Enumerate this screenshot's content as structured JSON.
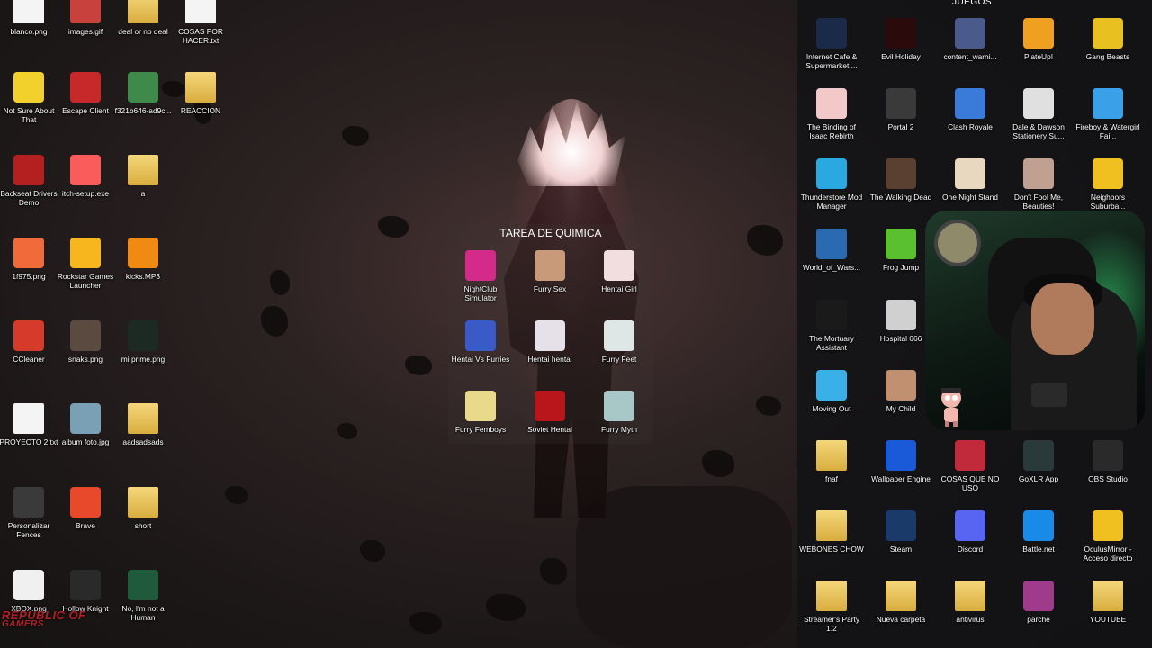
{
  "desktop_left": [
    {
      "label": "blanco.png",
      "icon": "white-image-icon",
      "color": "#f4f4f4"
    },
    {
      "label": "images.gif",
      "icon": "image-thumbnail-icon",
      "color": "#c9413d"
    },
    {
      "label": "deal or no deal",
      "icon": "folder-icon",
      "color": "#e9c45c"
    },
    {
      "label": "COSAS POR HACER.txt",
      "icon": "text-file-icon",
      "color": "#f4f4f4"
    },
    {
      "label": "Not Sure About That",
      "icon": "duck-icon",
      "color": "#f3d12c"
    },
    {
      "label": "Escape Client",
      "icon": "red-hexagon-icon",
      "color": "#c7282a"
    },
    {
      "label": "f321b646-ad9c...",
      "icon": "game-image-icon",
      "color": "#3f8a4a"
    },
    {
      "label": "REACCION",
      "icon": "folder-icon",
      "color": "#e9c45c"
    },
    {
      "label": "Backseat Drivers Demo",
      "icon": "red-car-icon",
      "color": "#b3201f"
    },
    {
      "label": "itch-setup.exe",
      "icon": "itch-gamepad-icon",
      "color": "#fa5c5c"
    },
    {
      "label": "a",
      "icon": "folder-icon",
      "color": "#e9c45c"
    },
    {
      "label": "1f975.png",
      "icon": "hot-face-emoji-icon",
      "color": "#f06a3a"
    },
    {
      "label": "Rockstar Games Launcher",
      "icon": "rockstar-icon",
      "color": "#f7b51e"
    },
    {
      "label": "kicks.MP3",
      "icon": "vlc-cone-icon",
      "color": "#f08a13"
    },
    {
      "label": "CCleaner",
      "icon": "ccleaner-icon",
      "color": "#d63a2a"
    },
    {
      "label": "snaks.png",
      "icon": "image-thumbnail-icon",
      "color": "#5a4a40"
    },
    {
      "label": "mi prime.png",
      "icon": "dark-image-icon",
      "color": "#1d2a24"
    },
    {
      "label": "PROYECTO 2.txt",
      "icon": "text-file-icon",
      "color": "#f4f4f4"
    },
    {
      "label": "album foto.jpg",
      "icon": "minecraft-image-icon",
      "color": "#7aa0b5"
    },
    {
      "label": "aadsadsads",
      "icon": "folder-icon",
      "color": "#e9c45c"
    },
    {
      "label": "Personalizar Fences",
      "icon": "fences-icon",
      "color": "#3a3a3a"
    },
    {
      "label": "Brave",
      "icon": "brave-lion-icon",
      "color": "#e8492b"
    },
    {
      "label": "short",
      "icon": "folder-icon",
      "color": "#e9c45c"
    },
    {
      "label": "XBOX.png",
      "icon": "game-pass-icon",
      "color": "#f0f0f0"
    },
    {
      "label": "Hollow Knight",
      "icon": "hollow-knight-icon",
      "color": "#2a2a2a"
    },
    {
      "label": "No, I'm not a Human",
      "icon": "green-face-icon",
      "color": "#1f5a3c"
    }
  ],
  "fence": {
    "title": "TAREA DE QUIMICA",
    "items": [
      {
        "label": "NightClub Simulator",
        "icon": "nightclub-icon",
        "color": "#d42a8a"
      },
      {
        "label": "Furry Sex",
        "icon": "anime-thumbnail-icon",
        "color": "#c89a7a"
      },
      {
        "label": "Hentai Girl",
        "icon": "anime-girl-icon",
        "color": "#f2dede"
      },
      {
        "label": "Hentai Vs Furries",
        "icon": "anime-blue-icon",
        "color": "#3a5ac8"
      },
      {
        "label": "Hentai hentai",
        "icon": "anime-white-hair-icon",
        "color": "#e6e0e8"
      },
      {
        "label": "Furry Feet",
        "icon": "furry-feet-icon",
        "color": "#dfe6e6"
      },
      {
        "label": "Furry Femboys",
        "icon": "anime-blonde-icon",
        "color": "#e9d98a"
      },
      {
        "label": "Soviet Hentai",
        "icon": "hentai-logo-icon",
        "color": "#b8161b"
      },
      {
        "label": "Furry Myth",
        "icon": "furry-myth-icon",
        "color": "#a8c8c8"
      }
    ]
  },
  "panel": {
    "title": "JUEGOS",
    "items": [
      {
        "label": "Internet Cafe & Supermarket ...",
        "icon": "internet-cafe-icon",
        "color": "#1c2a4a"
      },
      {
        "label": "Evil Holiday",
        "icon": "evil-holiday-icon",
        "color": "#2a0a0a"
      },
      {
        "label": "content_warni...",
        "icon": "content-warning-icon",
        "color": "#4a5a8a"
      },
      {
        "label": "PlateUp!",
        "icon": "plateup-icon",
        "color": "#f0a020"
      },
      {
        "label": "Gang Beasts",
        "icon": "gang-beasts-icon",
        "color": "#e8c020"
      },
      {
        "label": "The Binding of Isaac Rebirth",
        "icon": "isaac-icon",
        "color": "#f2c8c8"
      },
      {
        "label": "Portal 2",
        "icon": "portal-icon",
        "color": "#3a3a3a"
      },
      {
        "label": "Clash Royale",
        "icon": "clash-royale-icon",
        "color": "#3a7ad8"
      },
      {
        "label": "Dale & Dawson Stationery Su...",
        "icon": "printer-icon",
        "color": "#e0e0e0"
      },
      {
        "label": "Fireboy & Watergirl Fai...",
        "icon": "fireboy-watergirl-icon",
        "color": "#3aa0e8"
      },
      {
        "label": "Thunderstore Mod Manager",
        "icon": "thunderstore-icon",
        "color": "#2aa8e0"
      },
      {
        "label": "The Walking Dead",
        "icon": "zombie-icon",
        "color": "#5a4030"
      },
      {
        "label": "One Night Stand",
        "icon": "one-night-stand-icon",
        "color": "#e8d8c0"
      },
      {
        "label": "Don't Fool Me, Beauties!",
        "icon": "beauties-icon",
        "color": "#c0a090"
      },
      {
        "label": "Neighbors Suburba...",
        "icon": "neighbors-icon",
        "color": "#f0c020"
      },
      {
        "label": "World_of_Wars...",
        "icon": "world-of-warships-icon",
        "color": "#2a6ab0"
      },
      {
        "label": "Frog Jump",
        "icon": "frog-icon",
        "color": "#5ac030"
      },
      {
        "label": "The Mortuary Assistant",
        "icon": "mortuary-icon",
        "color": "#1a1a1a"
      },
      {
        "label": "Hospital 666",
        "icon": "hospital-icon",
        "color": "#d0d0d0"
      },
      {
        "label": "Moving Out",
        "icon": "moving-out-icon",
        "color": "#3ab0e8"
      },
      {
        "label": "My Child",
        "icon": "my-child-icon",
        "color": "#c09070"
      },
      {
        "label": "fnaf",
        "icon": "folder-icon",
        "color": "#e9c45c"
      },
      {
        "label": "Wallpaper Engine",
        "icon": "wallpaper-engine-icon",
        "color": "#1a5ad8"
      },
      {
        "label": "COSAS QUE NO USO",
        "icon": "winrar-folder-icon",
        "color": "#c02a3a"
      },
      {
        "label": "GoXLR App",
        "icon": "goxlr-icon",
        "color": "#2a3a3a"
      },
      {
        "label": "OBS Studio",
        "icon": "obs-icon",
        "color": "#2a2a2a"
      },
      {
        "label": "WEBONES CHOW",
        "icon": "folder-icon",
        "color": "#e9c45c"
      },
      {
        "label": "Steam",
        "icon": "steam-icon",
        "color": "#1a3a6a"
      },
      {
        "label": "Discord",
        "icon": "discord-icon",
        "color": "#5865f2"
      },
      {
        "label": "Battle.net",
        "icon": "battlenet-icon",
        "color": "#1a8ae8"
      },
      {
        "label": "OculusMirror - Acceso directo",
        "icon": "warning-icon",
        "color": "#f0c020"
      },
      {
        "label": "Streamer's Party 1.2",
        "icon": "folder-icon",
        "color": "#e9c45c"
      },
      {
        "label": "Nueva carpeta",
        "icon": "folder-icon",
        "color": "#e9c45c"
      },
      {
        "label": "antivirus",
        "icon": "folder-icon",
        "color": "#e9c45c"
      },
      {
        "label": "parche",
        "icon": "winrar-icon",
        "color": "#a03a8a"
      },
      {
        "label": "YOUTUBE",
        "icon": "folder-icon",
        "color": "#e9c45c"
      }
    ]
  },
  "logo": {
    "line1": "REPUBLIC OF",
    "line2": "GAMERS",
    "color": "#b32026"
  }
}
